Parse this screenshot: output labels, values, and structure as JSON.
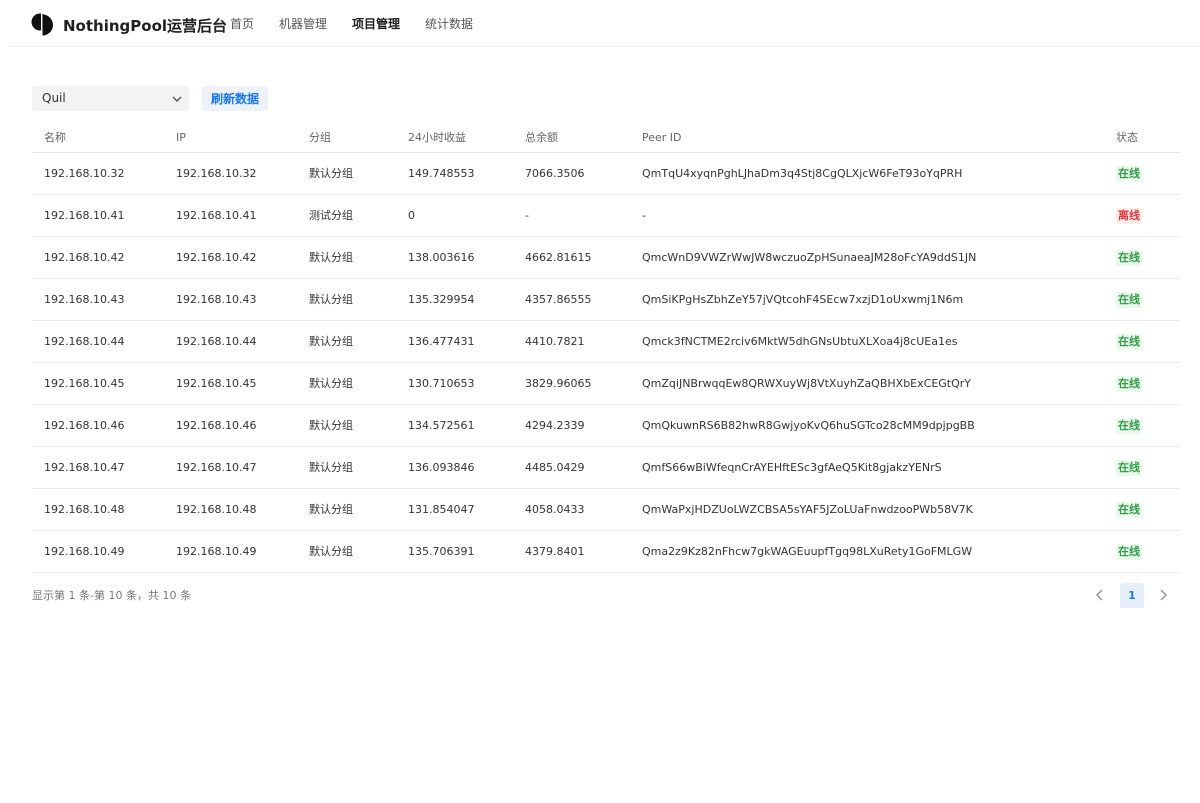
{
  "app": {
    "brand": "NothingPool运营后台",
    "logo_icon": "half-circle-logo-icon"
  },
  "nav": {
    "items": [
      {
        "label": "首页",
        "active": false
      },
      {
        "label": "机器管理",
        "active": false
      },
      {
        "label": "项目管理",
        "active": true
      },
      {
        "label": "统计数据",
        "active": false
      }
    ]
  },
  "toolbar": {
    "project_select_value": "Quil",
    "refresh_label": "刷新数据"
  },
  "table": {
    "columns": [
      "名称",
      "IP",
      "分组",
      "24小时收益",
      "总余额",
      "Peer ID",
      "状态"
    ],
    "rows": [
      {
        "name": "192.168.10.32",
        "ip": "192.168.10.32",
        "group": "默认分组",
        "earn24h": "149.748553",
        "balance": "7066.3506",
        "peer_id": "QmTqU4xyqnPghLJhaDm3q4Stj8CgQLXjcW6FeT93oYqPRH",
        "status": "在线",
        "online": true
      },
      {
        "name": "192.168.10.41",
        "ip": "192.168.10.41",
        "group": "测试分组",
        "earn24h": "0",
        "balance": "-",
        "peer_id": "-",
        "status": "离线",
        "online": false
      },
      {
        "name": "192.168.10.42",
        "ip": "192.168.10.42",
        "group": "默认分组",
        "earn24h": "138.003616",
        "balance": "4662.81615",
        "peer_id": "QmcWnD9VWZrWwJW8wczuoZpHSunaeaJM28oFcYA9ddS1JN",
        "status": "在线",
        "online": true
      },
      {
        "name": "192.168.10.43",
        "ip": "192.168.10.43",
        "group": "默认分组",
        "earn24h": "135.329954",
        "balance": "4357.86555",
        "peer_id": "QmSiKPgHsZbhZeY57jVQtcohF4SEcw7xzjD1oUxwmj1N6m",
        "status": "在线",
        "online": true
      },
      {
        "name": "192.168.10.44",
        "ip": "192.168.10.44",
        "group": "默认分组",
        "earn24h": "136.477431",
        "balance": "4410.7821",
        "peer_id": "Qmck3fNCTME2rciv6MktW5dhGNsUbtuXLXoa4j8cUEa1es",
        "status": "在线",
        "online": true
      },
      {
        "name": "192.168.10.45",
        "ip": "192.168.10.45",
        "group": "默认分组",
        "earn24h": "130.710653",
        "balance": "3829.96065",
        "peer_id": "QmZqiJNBrwqqEw8QRWXuyWj8VtXuyhZaQBHXbExCEGtQrY",
        "status": "在线",
        "online": true
      },
      {
        "name": "192.168.10.46",
        "ip": "192.168.10.46",
        "group": "默认分组",
        "earn24h": "134.572561",
        "balance": "4294.2339",
        "peer_id": "QmQkuwnRS6B82hwR8GwjyoKvQ6huSGTco28cMM9dpjpgBB",
        "status": "在线",
        "online": true
      },
      {
        "name": "192.168.10.47",
        "ip": "192.168.10.47",
        "group": "默认分组",
        "earn24h": "136.093846",
        "balance": "4485.0429",
        "peer_id": "QmfS66wBiWfeqnCrAYEHftESc3gfAeQ5Kit8gjakzYENrS",
        "status": "在线",
        "online": true
      },
      {
        "name": "192.168.10.48",
        "ip": "192.168.10.48",
        "group": "默认分组",
        "earn24h": "131.854047",
        "balance": "4058.0433",
        "peer_id": "QmWaPxjHDZUoLWZCBSA5sYAF5JZoLUaFnwdzooPWb58V7K",
        "status": "在线",
        "online": true
      },
      {
        "name": "192.168.10.49",
        "ip": "192.168.10.49",
        "group": "默认分组",
        "earn24h": "135.706391",
        "balance": "4379.8401",
        "peer_id": "Qma2z9Kz82nFhcw7gkWAGEuupfTgq98LXuRety1GoFMLGW",
        "status": "在线",
        "online": true
      }
    ]
  },
  "pagination": {
    "summary": "显示第 1 条-第 10 条，共 10 条",
    "current_page": "1",
    "prev_icon": "chevron-left-icon",
    "next_icon": "chevron-right-icon"
  },
  "colors": {
    "accent": "#1677ff",
    "online": "#2ea043",
    "offline": "#e5383b"
  }
}
